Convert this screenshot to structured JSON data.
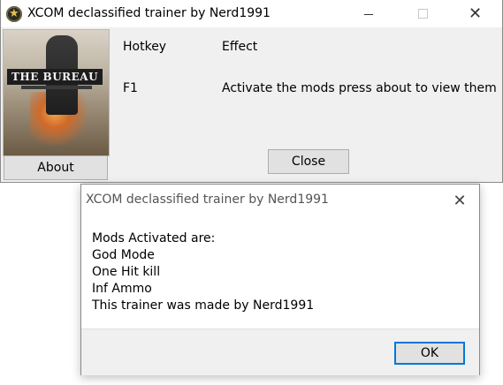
{
  "main_window": {
    "title": "XCOM declassified trainer by Nerd1991",
    "icon": "star-badge-icon",
    "controls": {
      "minimize": "minimize-icon",
      "maximize": "maximize-icon",
      "close": "✕"
    },
    "about_label": "About",
    "close_label": "Close",
    "cover_text": "THE BUREAU",
    "table": {
      "headers": {
        "hotkey": "Hotkey",
        "effect": "Effect"
      },
      "rows": [
        {
          "key": "F1",
          "effect": "Activate the mods press about to view them"
        }
      ]
    }
  },
  "message_box": {
    "title": "XCOM declassified trainer by Nerd1991",
    "close_glyph": "✕",
    "lines": [
      "Mods Activated are:",
      "God Mode",
      "One Hit kill",
      "Inf Ammo",
      "This trainer was made by Nerd1991"
    ],
    "ok_label": "OK"
  },
  "colors": {
    "window_bg": "#f0f0f0",
    "accent": "#0078d7",
    "button_bg": "#e1e1e1"
  }
}
